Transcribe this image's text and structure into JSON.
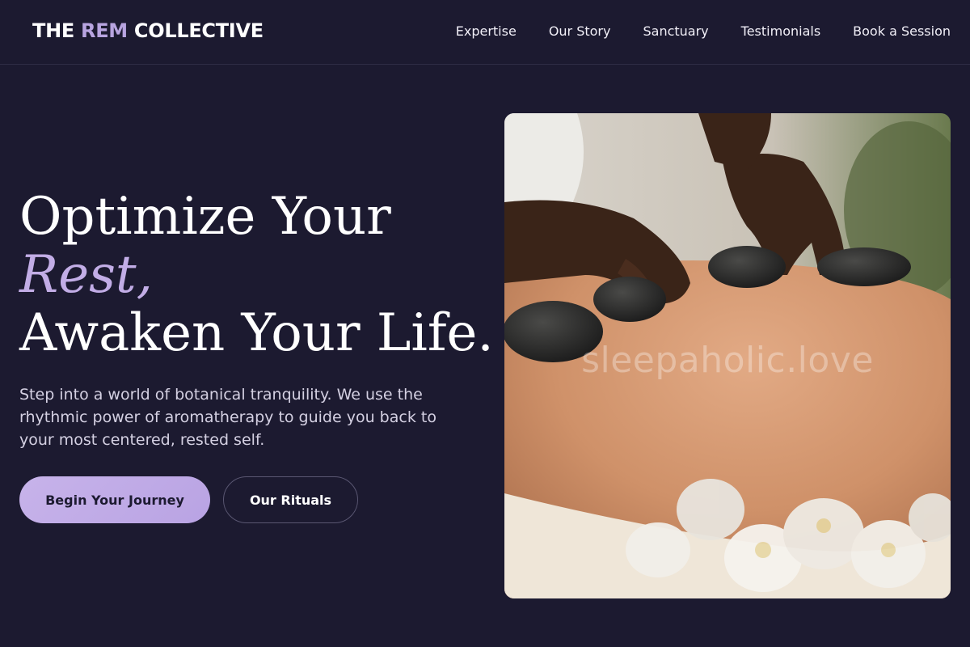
{
  "header": {
    "logo": {
      "part1": "THE ",
      "accent": "REM",
      "part2": " COLLECTIVE"
    },
    "nav": [
      "Expertise",
      "Our Story",
      "Sanctuary",
      "Testimonials",
      "Book a Session"
    ]
  },
  "hero": {
    "title_line1": "Optimize Your",
    "title_accent": "Rest,",
    "title_line3": "Awaken Your Life.",
    "subtitle": "Step into a world of botanical tranquility. We use the rhythmic power of aromatherapy to guide you back to your most centered, rested self.",
    "primary_button": "Begin Your Journey",
    "secondary_button": "Our Rituals",
    "image_watermark": "sleepaholic.love"
  },
  "colors": {
    "background": "#1c1a30",
    "accent": "#b8a4e0",
    "text": "#ffffff"
  }
}
